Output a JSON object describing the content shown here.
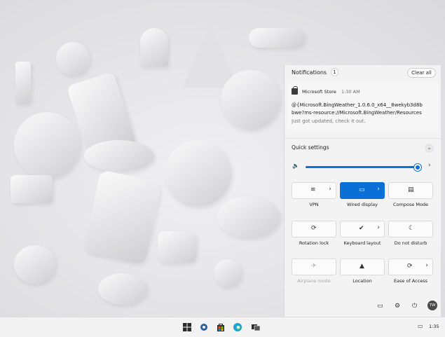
{
  "notifications": {
    "title": "Notifications",
    "count": "1",
    "clear_all": "Clear all",
    "item": {
      "app": "Microsoft Store",
      "time": "1:30 AM",
      "body_line1": "@{Microsoft.BingWeather_1.0.6.0_x64__8wekyb3d8b",
      "body_line2": "bwe?ms-resource://Microsoft.BingWeather/Resources",
      "subtitle": "Just got updated, check it out."
    }
  },
  "quick_settings": {
    "title": "Quick settings",
    "volume_level": 0.98,
    "tiles": [
      {
        "label": "VPN",
        "icon": "vpn-icon",
        "active": false,
        "has_chevron": true
      },
      {
        "label": "Wired display",
        "icon": "wired-display-icon",
        "active": true,
        "has_chevron": true
      },
      {
        "label": "Compose Mode",
        "icon": "compose-mode-icon",
        "active": false,
        "has_chevron": false
      },
      {
        "label": "Rotation lock",
        "icon": "rotation-lock-icon",
        "active": false,
        "has_chevron": false
      },
      {
        "label": "Keyboard layout",
        "icon": "keyboard-layout-icon",
        "active": false,
        "has_chevron": true
      },
      {
        "label": "Do not disturb",
        "icon": "moon-icon",
        "active": false,
        "has_chevron": false
      },
      {
        "label": "Airplane mode",
        "icon": "airplane-icon",
        "active": false,
        "disabled": true,
        "has_chevron": false
      },
      {
        "label": "Location",
        "icon": "location-icon",
        "active": false,
        "has_chevron": false
      },
      {
        "label": "Ease of Access",
        "icon": "ease-of-access-icon",
        "active": false,
        "has_chevron": true
      }
    ],
    "footer": {
      "avatar_initials": "TW",
      "icons": [
        "battery-icon",
        "settings-icon",
        "power-icon"
      ]
    }
  },
  "taskbar": {
    "time": "1:35",
    "icons": [
      "start-icon",
      "settings-icon",
      "store-icon",
      "edge-icon",
      "task-view-icon"
    ]
  },
  "colors": {
    "accent": "#0a6fd6",
    "panel": "#f3f3f4"
  }
}
